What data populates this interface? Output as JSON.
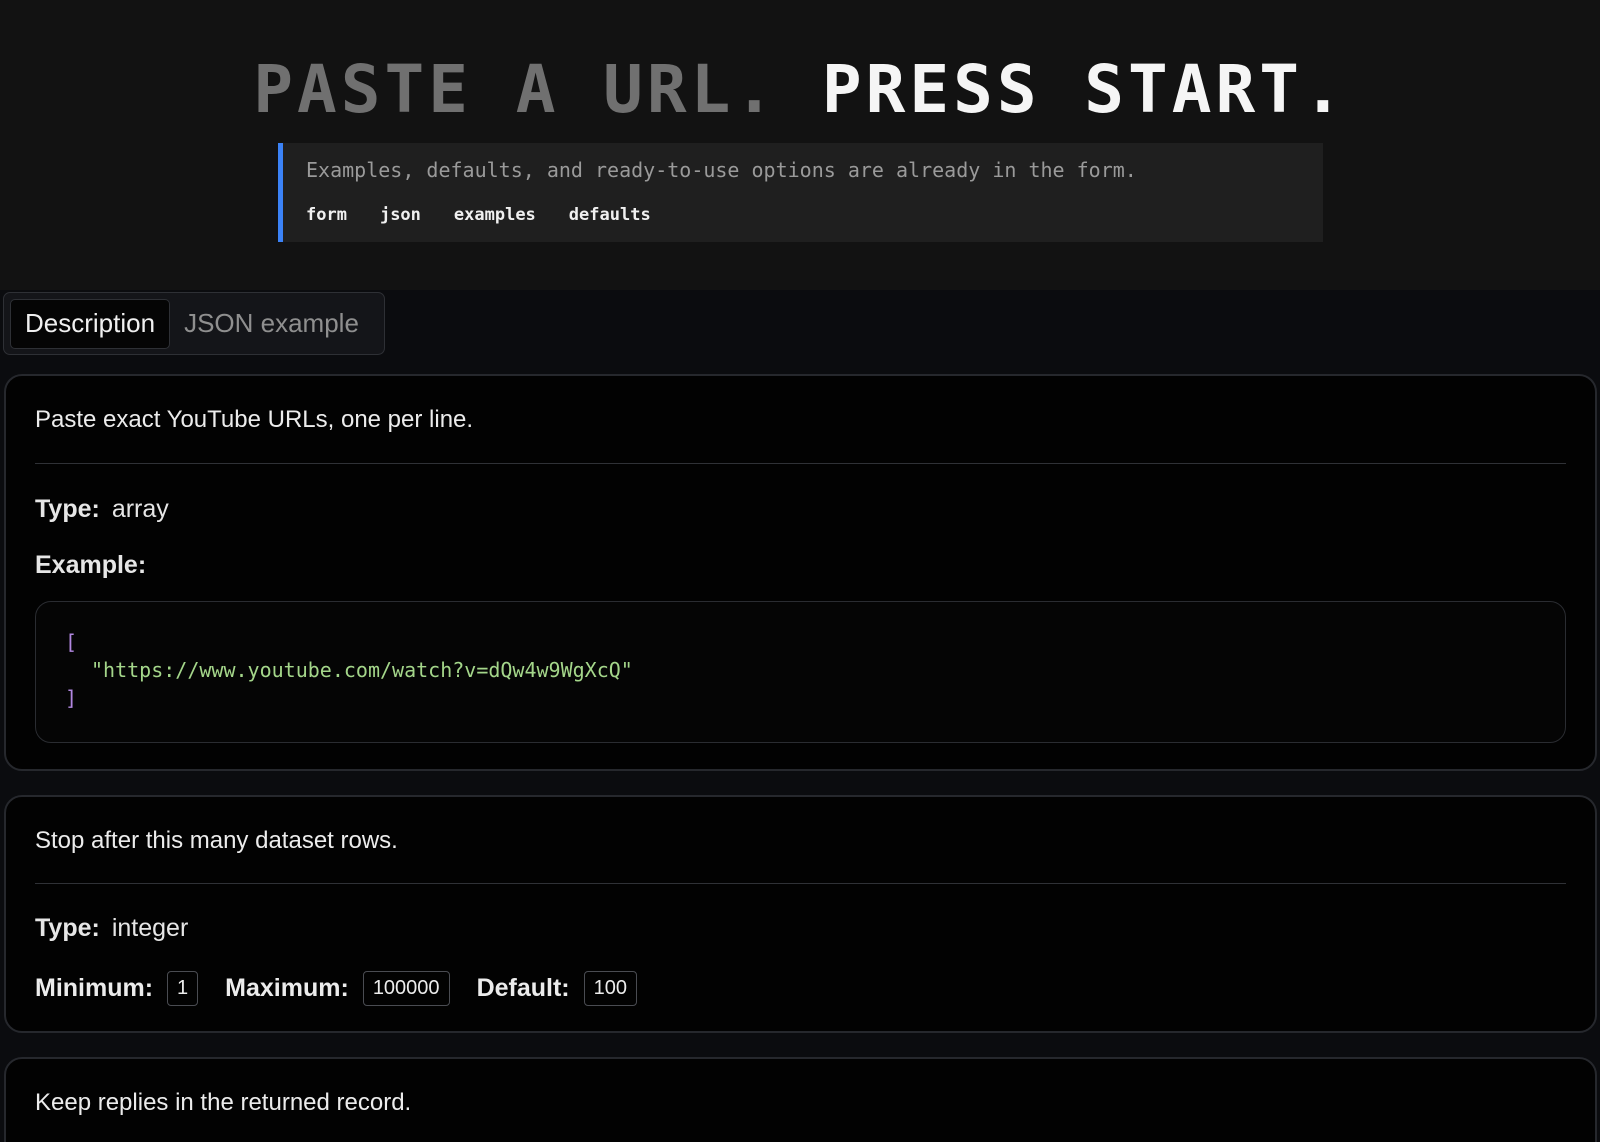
{
  "hero": {
    "title_dim": "PASTE A URL.",
    "title_bright": "PRESS START.",
    "subtitle": "Examples, defaults, and ready-to-use options are already in the form.",
    "tags": [
      "form",
      "json",
      "examples",
      "defaults"
    ]
  },
  "tabs": [
    {
      "label": "Description",
      "active": true
    },
    {
      "label": "JSON example",
      "active": false
    }
  ],
  "fields": [
    {
      "description": "Paste exact YouTube URLs, one per line.",
      "type_label": "Type:",
      "type": "array",
      "example_label": "Example:",
      "example": {
        "open": "[",
        "value": "\"https://www.youtube.com/watch?v=dQw4w9WgXcQ\"",
        "close": "]"
      }
    },
    {
      "description": "Stop after this many dataset rows.",
      "type_label": "Type:",
      "type": "integer",
      "minimum_label": "Minimum:",
      "minimum": "1",
      "maximum_label": "Maximum:",
      "maximum": "100000",
      "default_label": "Default:",
      "default": "100"
    },
    {
      "description": "Keep replies in the returned record."
    }
  ],
  "colors": {
    "accent": "#3b82f6",
    "json_bracket": "#b187e0",
    "json_string": "#a4d68a"
  }
}
